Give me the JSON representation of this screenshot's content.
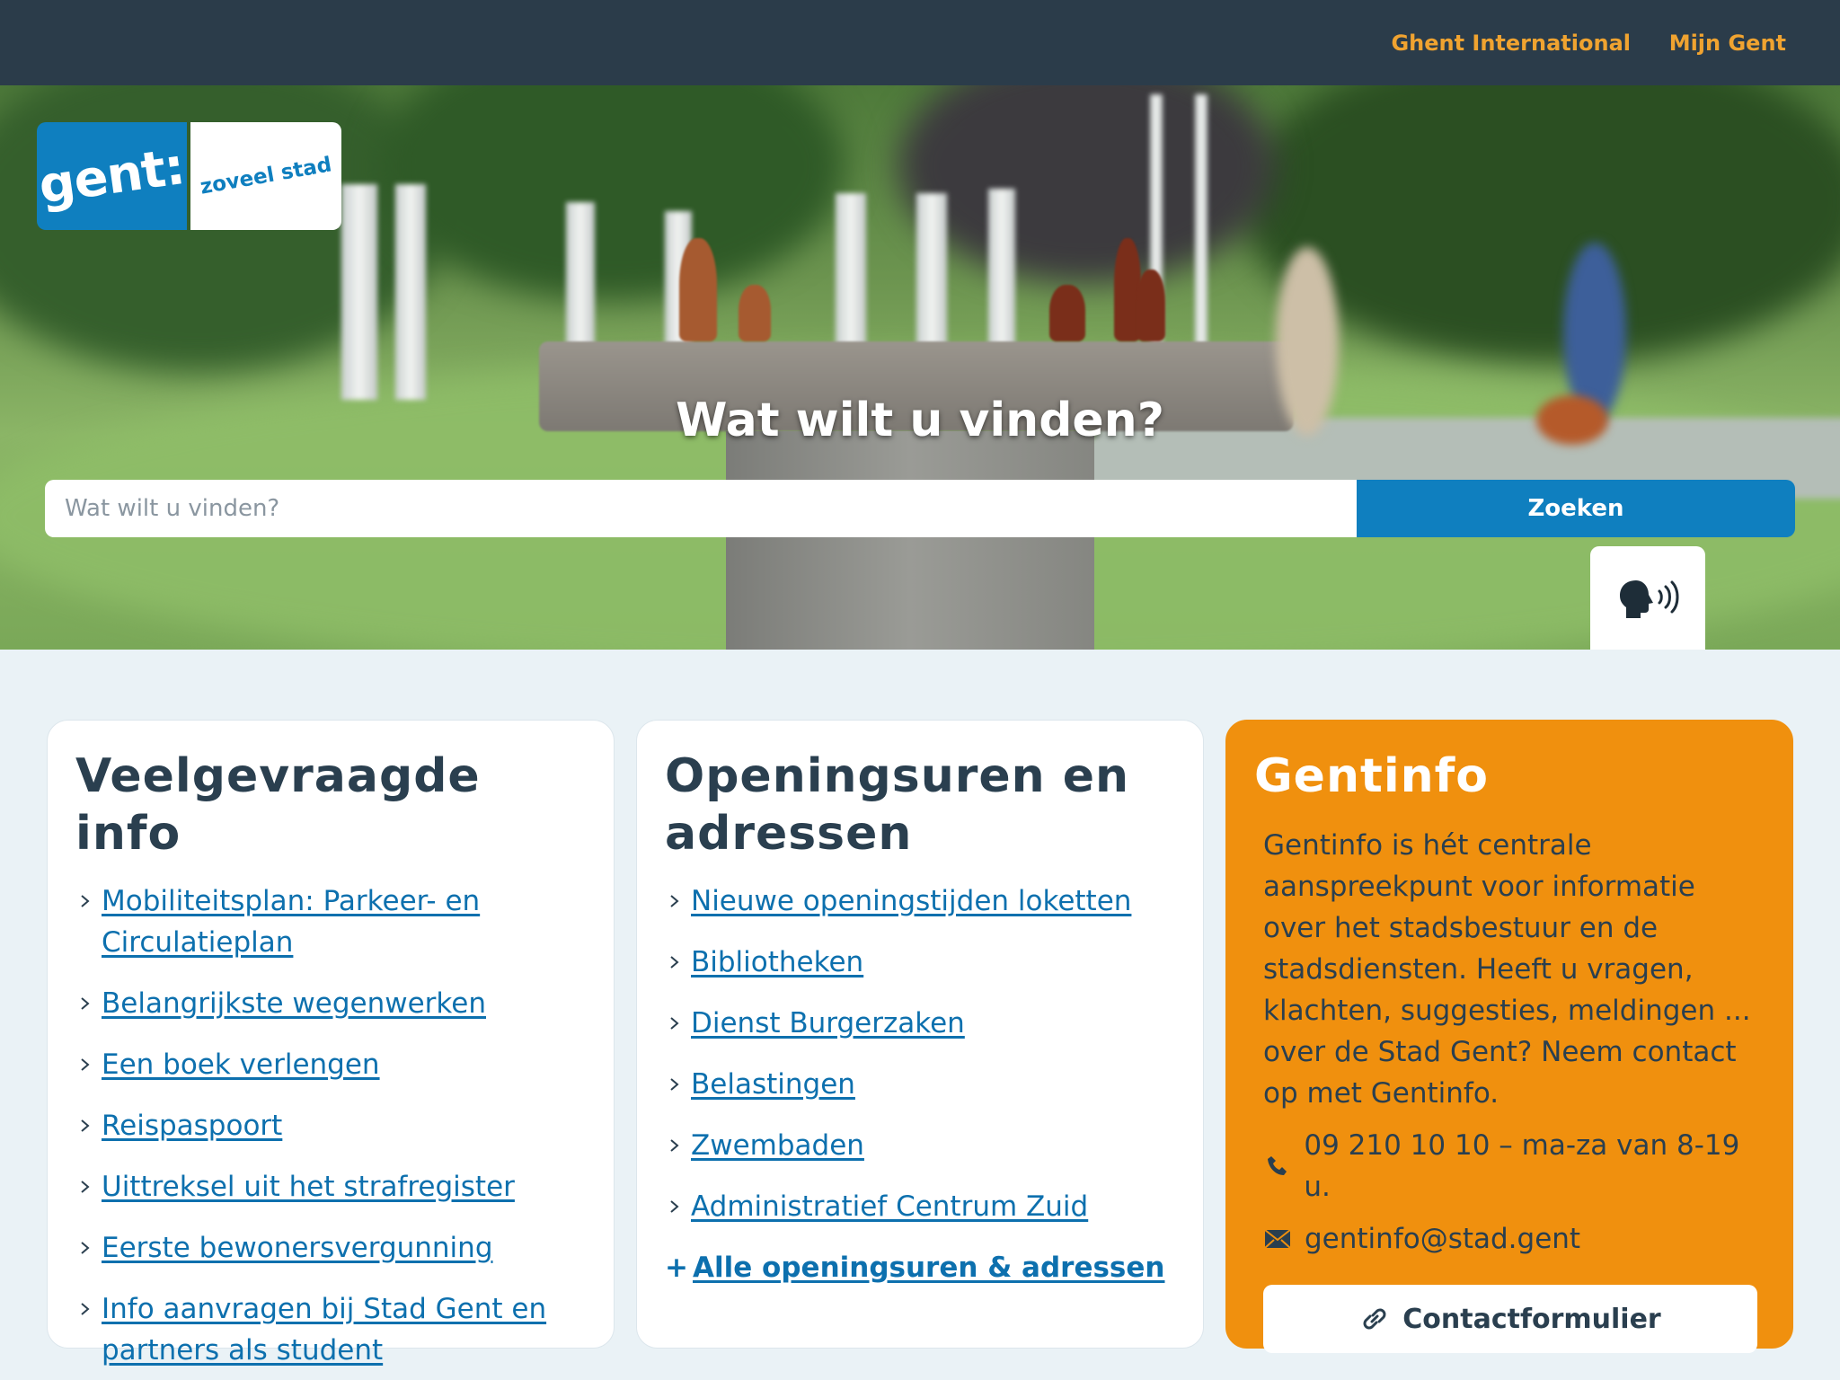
{
  "topbar": {
    "links": [
      "Ghent International",
      "Mijn Gent"
    ]
  },
  "logo": {
    "main": "gent:",
    "tagline": "zoveel stad"
  },
  "hero": {
    "title": "Wat wilt u vinden?",
    "search_placeholder": "Wat wilt u vinden?",
    "search_button": "Zoeken"
  },
  "faq": {
    "title": "Veelgevraagde info",
    "items": [
      "Mobiliteitsplan: Parkeer- en Circulatieplan",
      "Belangrijkste wegenwerken",
      "Een boek verlengen",
      "Reispaspoort",
      "Uittreksel uit het strafregister",
      "Eerste bewonersvergunning",
      "Info aanvragen bij Stad Gent en partners als student"
    ]
  },
  "hours": {
    "title": "Openingsuren en adressen",
    "items": [
      "Nieuwe openingstijden loketten",
      "Bibliotheken",
      "Dienst Burgerzaken",
      "Belastingen",
      "Zwembaden",
      "Administratief Centrum Zuid"
    ],
    "all_link": "Alle openingsuren & adressen"
  },
  "gentinfo": {
    "title": "Gentinfo",
    "description": "Gentinfo is hét centrale aanspreekpunt voor informatie over het stadsbestuur en de stadsdiensten. Heeft u vragen, klachten, suggesties, meldingen ... over de Stad Gent? Neem contact op met Gentinfo.",
    "phone": "09 210 10 10 – ma-za van 8-19 u.",
    "email": "gentinfo@stad.gent",
    "contact_button": "Contactformulier"
  },
  "colors": {
    "topbar": "#2b3c4a",
    "accent_orange": "#f0900e",
    "brand_blue": "#0f7fbf",
    "link_blue": "#0d70ae",
    "page_bg": "#eaf2f6"
  },
  "icons": {
    "list_bullet": "chevron-right-icon",
    "readspeaker": "speaking-head-icon",
    "phone": "phone-icon",
    "email": "envelope-icon",
    "contact": "link-icon"
  }
}
